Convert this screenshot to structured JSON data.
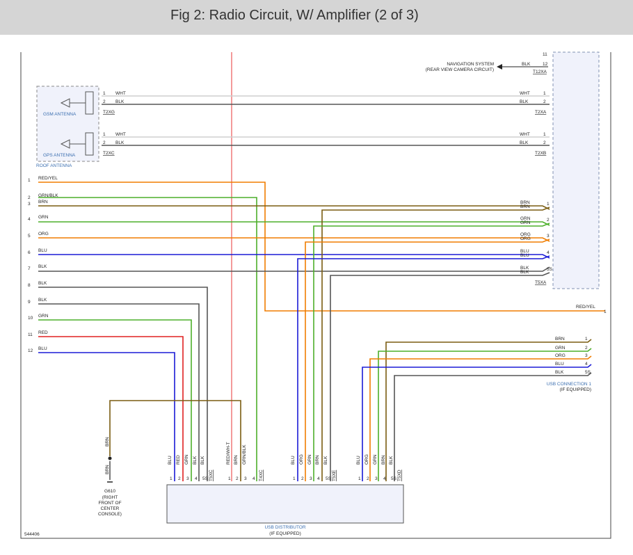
{
  "header": {
    "title": "Fig 2: Radio Circuit, W/ Amplifier (2 of 3)"
  },
  "colors": {
    "RED/YEL": "#f07d00",
    "GRN/BLK": "#4caf2a",
    "BRN": "#7a5c10",
    "GRN": "#4caf2a",
    "ORG": "#f07d00",
    "BLU": "#1a1ad6",
    "BLK": "#555555",
    "RED": "#e02020",
    "WHT": "#cfcfcf",
    "RED/WHT": "#f08080",
    "component_border": "#8090b0",
    "component_fill": "#f0f2fb",
    "label_blue": "#3b6fb0"
  },
  "navigation": {
    "label_line1": "NAVIGATION SYSTEM",
    "label_line2": "(REAR VIEW CAMERA CIRCUIT)",
    "wire_color": "BLK",
    "pins": [
      "11",
      "12"
    ],
    "connector": "T12XA"
  },
  "roof_antenna": {
    "label": "ROOF ANTENNA",
    "gsm": {
      "label": "GSM ANTENNA",
      "connector_left": "T2XG",
      "connector_right": "T2XA",
      "wires": [
        {
          "pin": "1",
          "color": "WHT"
        },
        {
          "pin": "2",
          "color": "BLK"
        }
      ]
    },
    "gps": {
      "label": "GPS ANTENNA",
      "connector_left": "T2XC",
      "connector_right": "T2XB",
      "wires": [
        {
          "pin": "1",
          "color": "WHT"
        },
        {
          "pin": "2",
          "color": "BLK"
        }
      ]
    }
  },
  "left_wires": [
    {
      "pin": "1",
      "color": "RED/YEL"
    },
    {
      "pin": "2",
      "color": "GRN/BLK"
    },
    {
      "pin": "3",
      "color": "BRN"
    },
    {
      "pin": "4",
      "color": "GRN"
    },
    {
      "pin": "5",
      "color": "ORG"
    },
    {
      "pin": "6",
      "color": "BLU"
    },
    {
      "pin": "7",
      "color": "BLK"
    },
    {
      "pin": "8",
      "color": "BLK"
    },
    {
      "pin": "9",
      "color": "BLK"
    },
    {
      "pin": "10",
      "color": "GRN"
    },
    {
      "pin": "11",
      "color": "RED"
    },
    {
      "pin": "12",
      "color": "BLU"
    }
  ],
  "t5xa": {
    "connector": "T5XA",
    "wires": [
      {
        "color": "BRN",
        "pin": "1"
      },
      {
        "color": "BRN",
        "pin": ""
      },
      {
        "color": "GRN",
        "pin": "2"
      },
      {
        "color": "GRN",
        "pin": ""
      },
      {
        "color": "ORG",
        "pin": "3"
      },
      {
        "color": "ORG",
        "pin": ""
      },
      {
        "color": "BLU",
        "pin": "4"
      },
      {
        "color": "BLU",
        "pin": ""
      },
      {
        "color": "BLK",
        "pin": "5S"
      },
      {
        "color": "BLK",
        "pin": ""
      }
    ]
  },
  "red_yel_out": {
    "color": "RED/YEL",
    "pin": "1"
  },
  "usb_connection": {
    "label_line1": "USB CONNECTION 1",
    "label_line2": "(IF EQUIPPED)",
    "wires": [
      {
        "color": "BRN",
        "pin": "1"
      },
      {
        "color": "GRN",
        "pin": "2"
      },
      {
        "color": "ORG",
        "pin": "3"
      },
      {
        "color": "BLU",
        "pin": "4"
      },
      {
        "color": "BLK",
        "pin": "5S"
      }
    ]
  },
  "usb_distributor": {
    "label_line1": "USB DISTRIBUTOR",
    "label_line2": "(IF EQUIPPED)",
    "groups": [
      {
        "connector": "T5XC",
        "wires": [
          {
            "color": "BLU",
            "pin": "1"
          },
          {
            "color": "RED",
            "pin": "2"
          },
          {
            "color": "GRN",
            "pin": "3"
          },
          {
            "color": "BLK",
            "pin": "4"
          },
          {
            "color": "BLK",
            "pin": "5S"
          }
        ]
      },
      {
        "connector": "T4XC",
        "wires": [
          {
            "color": "RED/WH-T",
            "pin": "1"
          },
          {
            "color": "BRN",
            "pin": "2"
          },
          {
            "color": "GRN/BLK",
            "pin": "3"
          },
          {
            "color": "",
            "pin": "4"
          }
        ]
      },
      {
        "connector": "T5XE",
        "wires": [
          {
            "color": "BLU",
            "pin": "1"
          },
          {
            "color": "ORG",
            "pin": "2"
          },
          {
            "color": "GRN",
            "pin": "3"
          },
          {
            "color": "BRN",
            "pin": "4"
          },
          {
            "color": "BLK",
            "pin": "5S"
          }
        ]
      },
      {
        "connector": "T5XD",
        "wires": [
          {
            "color": "BLU",
            "pin": "1"
          },
          {
            "color": "ORG",
            "pin": "2"
          },
          {
            "color": "GRN",
            "pin": "3"
          },
          {
            "color": "BRN",
            "pin": "4"
          },
          {
            "color": "BLK",
            "pin": "5S"
          }
        ]
      }
    ]
  },
  "ground": {
    "wire_color": "BRN",
    "id": "G610",
    "desc": [
      "(RIGHT",
      "FRONT OF",
      "CENTER",
      "CONSOLE)"
    ]
  },
  "figure_id": "544406"
}
